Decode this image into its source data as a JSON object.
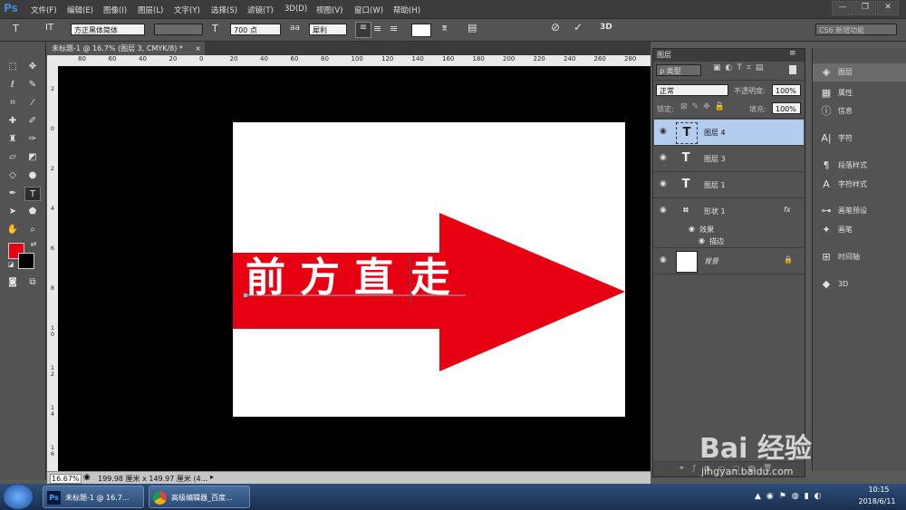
{
  "menubar": {
    "logo": "Ps",
    "items": [
      "文件(F)",
      "编辑(E)",
      "图像(I)",
      "图层(L)",
      "文字(Y)",
      "选择(S)",
      "滤镜(T)",
      "3D(D)",
      "视图(V)",
      "窗口(W)",
      "帮助(H)"
    ],
    "window_buttons": [
      "—",
      "❐",
      "✕"
    ]
  },
  "options": {
    "tool_icon": "T",
    "orient_icon": "IT",
    "font_family": "方正黑体简体",
    "font_style": "-",
    "size_icon": "T",
    "font_size": "700 点",
    "aa_icon": "aa",
    "antialias": "犀利",
    "threed": "3D",
    "workspace": "CS6 新增功能"
  },
  "document": {
    "tab_title": "未标题-1 @ 16.7% (图层 3, CMYK/8) *",
    "tab_close": "×",
    "text_content": [
      "前",
      "方",
      "直",
      "走"
    ],
    "arrow_color": "#e60012"
  },
  "ruler": {
    "top_labels": [
      "80",
      "60",
      "40",
      "20",
      "0",
      "20",
      "40",
      "60",
      "80",
      "100",
      "120",
      "140",
      "160",
      "180",
      "200",
      "220",
      "240",
      "260",
      "280"
    ],
    "left_labels": [
      "2",
      "0",
      "2",
      "4",
      "6",
      "8",
      "1 0",
      "1 2",
      "1 4",
      "1 6"
    ]
  },
  "status": {
    "zoom": "16.67%",
    "doc_size": "199.98 厘米 x 149.97 厘米 (4..."
  },
  "layers_panel": {
    "tabs": [
      "图层"
    ],
    "filter_label": "ρ 类型",
    "blend_mode": "正常",
    "opacity_label": "不透明度:",
    "opacity_value": "100%",
    "lock_label": "锁定:",
    "fill_label": "填充:",
    "fill_value": "100%",
    "layers": [
      {
        "name": "图层 4",
        "type": "text"
      },
      {
        "name": "图层 3",
        "type": "text"
      },
      {
        "name": "图层 1",
        "type": "text"
      },
      {
        "name": "形状 1",
        "type": "shape",
        "fx": "fx"
      },
      {
        "name": "背景",
        "type": "background"
      }
    ],
    "effects_label": "效果",
    "stroke_label": "描边"
  },
  "side_panels": [
    {
      "label": "图层",
      "icon": "layers-icon"
    },
    {
      "label": "属性",
      "icon": "properties-icon"
    },
    {
      "label": "信息",
      "icon": "info-icon"
    },
    {
      "label": "字符",
      "icon": "character-icon"
    },
    {
      "label": "段落样式",
      "icon": "paragraph-style-icon"
    },
    {
      "label": "字符样式",
      "icon": "character-style-icon"
    },
    {
      "label": "画笔预设",
      "icon": "brush-preset-icon"
    },
    {
      "label": "画笔",
      "icon": "brush-icon"
    },
    {
      "label": "时间轴",
      "icon": "timeline-icon"
    },
    {
      "label": "3D",
      "icon": "3d-icon"
    }
  ],
  "taskbar": {
    "tasks": [
      "未标题-1 @ 16.7...",
      "高级编辑器_百度..."
    ],
    "time": "10:15",
    "date": "2018/6/11"
  },
  "watermark": {
    "brand": "Bai 经验",
    "url": "jingyan.baidu.com"
  }
}
